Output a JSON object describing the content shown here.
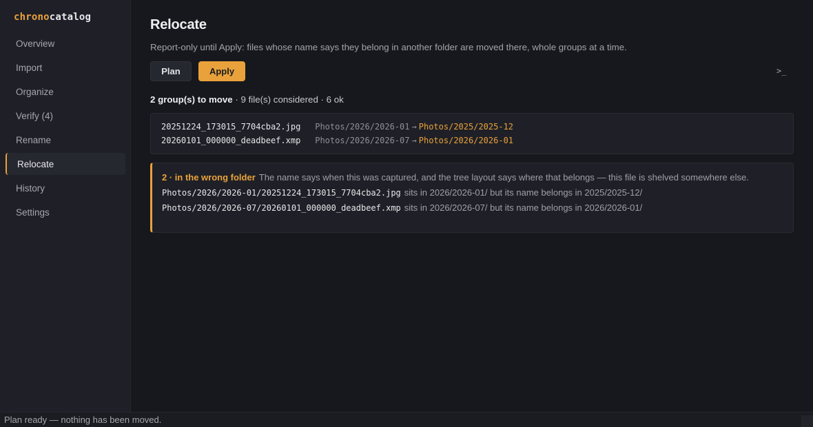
{
  "brand": {
    "part1": "chrono",
    "part2": "catalog"
  },
  "sidebar": {
    "items": [
      {
        "label": "Overview"
      },
      {
        "label": "Import"
      },
      {
        "label": "Organize"
      },
      {
        "label": "Verify (4)"
      },
      {
        "label": "Rename"
      },
      {
        "label": "Relocate",
        "active": true
      },
      {
        "label": "History"
      },
      {
        "label": "Settings"
      }
    ]
  },
  "page": {
    "title": "Relocate",
    "subtitle": "Report-only until Apply: files whose name says they belong in another folder are moved there, whole groups at a time."
  },
  "toolbar": {
    "plan_label": "Plan",
    "apply_label": "Apply",
    "terminal_glyph": ">_",
    "terminal_icon": "terminal-icon"
  },
  "summary": {
    "groups_text": "2 group(s) to move",
    "rest_text": " · 9 file(s) considered · 6 ok"
  },
  "moves": [
    {
      "file": "20251224_173015_7704cba2.jpg",
      "from": "Photos/2026/2026-01",
      "arrow": "→",
      "to": "Photos/2025/2025-12"
    },
    {
      "file": "20260101_000000_deadbeef.xmp",
      "from": "Photos/2026/2026-07",
      "arrow": "→",
      "to": "Photos/2026/2026-01"
    }
  ],
  "warning": {
    "title": "2 · in the wrong folder",
    "description": "The name says when this was captured, and the tree layout says where that belongs — this file is shelved somewhere else.",
    "items": [
      {
        "path": "Photos/2026/2026-01/20251224_173015_7704cba2.jpg",
        "note": "sits in 2026/2026-01/ but its name belongs in 2025/2025-12/"
      },
      {
        "path": "Photos/2026/2026-07/20260101_000000_deadbeef.xmp",
        "note": "sits in 2026/2026-07/ but its name belongs in 2026/2026-01/"
      }
    ]
  },
  "status": {
    "text": "Plan ready — nothing has been moved."
  },
  "colors": {
    "accent": "#e9a23b",
    "background": "#17181d",
    "sidebar": "#1f2027"
  }
}
